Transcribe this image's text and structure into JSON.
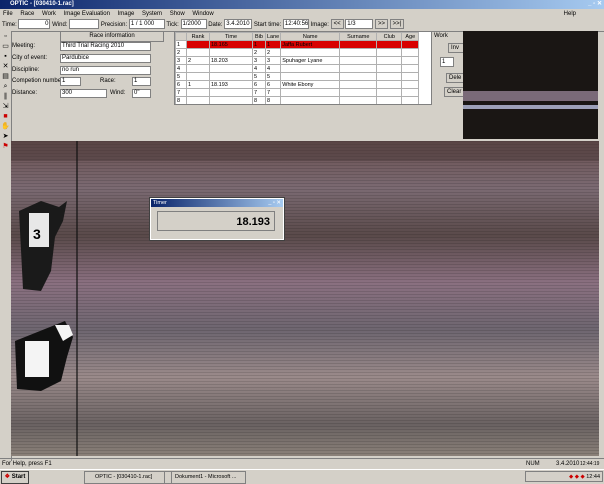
{
  "window": {
    "title": "OPTIC - [030410-1.rac]",
    "help": "Help"
  },
  "menu": [
    "File",
    "Race",
    "Work",
    "Image Evaluation",
    "Image",
    "System",
    "Show",
    "Window"
  ],
  "toolbar": {
    "time_label": "Time:",
    "time_value": "0",
    "wind_label": "Wind:",
    "wind_value": "",
    "precision_label": "Precision:",
    "precision_value": "1 / 1 000",
    "tick_label": "Tick:",
    "tick_value": "1/2000",
    "date_label": "Date:",
    "date_value": "3.4.2010",
    "start_label": "Start time:",
    "start_value": "12:40:56",
    "image_label": "Image:",
    "image_value": "1/3",
    "nav_prev": "<<",
    "nav_next": ">>",
    "nav_last": ">>|"
  },
  "race_info": {
    "heading": "Race information",
    "meeting_label": "Meeting:",
    "meeting": "Third Trial Racing 2010",
    "city_label": "City of event:",
    "city": "Pardubice",
    "discipline_label": "Discipline:",
    "discipline": "no run",
    "competition_label": "Competion number:",
    "competition": "1",
    "race_label": "Race:",
    "race": "1",
    "distance_label": "Distance:",
    "distance": "300",
    "wind_label": "Wind:",
    "wind": "0\""
  },
  "results": {
    "columns": [
      "",
      "Rank",
      "Time",
      "Bib",
      "Lane",
      "Name",
      "Surname",
      "Club",
      "Age"
    ],
    "rows": [
      [
        "1",
        "",
        "18.165",
        "1",
        "1",
        "Jaffa Rubert",
        "",
        "",
        ""
      ],
      [
        "2",
        "",
        "",
        "2",
        "2",
        "",
        "",
        "",
        ""
      ],
      [
        "3",
        "2",
        "18.203",
        "3",
        "3",
        "Spuhager Lyane",
        "",
        "",
        ""
      ],
      [
        "4",
        "",
        "",
        "4",
        "4",
        "",
        "",
        "",
        ""
      ],
      [
        "5",
        "",
        "",
        "5",
        "5",
        "",
        "",
        "",
        ""
      ],
      [
        "6",
        "1",
        "18.193",
        "6",
        "6",
        "White Ebony",
        "",
        "",
        ""
      ],
      [
        "7",
        "",
        "",
        "7",
        "7",
        "",
        "",
        "",
        ""
      ],
      [
        "8",
        "",
        "",
        "8",
        "8",
        "",
        "",
        "",
        ""
      ]
    ]
  },
  "work": {
    "label": "Work",
    "buttons": [
      "Inv",
      "Dele",
      "Clear"
    ],
    "spin": "1"
  },
  "timer": {
    "title": "Timer",
    "value": "18.193"
  },
  "status": {
    "text": "For Help, press F1",
    "num": "NUM",
    "date": "3.4.2010",
    "time": "12:44:19"
  },
  "taskbar": {
    "start": "Start",
    "task1": "OPTIC - [030410-1.rac]",
    "task2": "Dokument1 - Microsoft ...",
    "clock": "12:44"
  },
  "colors": {
    "title": "#0a246a",
    "highlight": "#d80000",
    "face": "#d4d0c8"
  }
}
